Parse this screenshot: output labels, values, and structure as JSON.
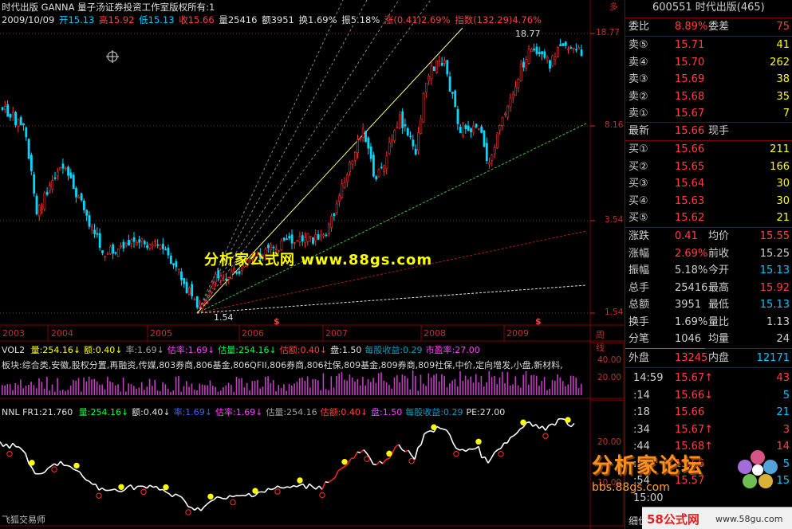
{
  "header": {
    "line1": "时代出版 GANNA 量子汤证券投资工作室版权所有:1",
    "line2": {
      "date": "2009/10/09",
      "open": "开15.13",
      "high": "高15.92",
      "low": "低15.13",
      "close": "收15.66",
      "vol": "量25416",
      "amount": "额3951",
      "turnover": "换1.69%",
      "amplitude": "振5.18%",
      "change": "涨(0.41)2.69%",
      "index": "指数(132.29)4.76%"
    },
    "sym_label": "多"
  },
  "price_axis": [
    "18.77",
    "8.16",
    "3.54",
    "1.54"
  ],
  "annotations": {
    "high_marker": "18.77",
    "low_marker": "1.54",
    "s_marker": "$"
  },
  "years": [
    "2003",
    "2004",
    "2005",
    "2006",
    "2007",
    "2008",
    "2009",
    "周线"
  ],
  "watermark_center": "分析家公式网  www.88gs.com",
  "vol_panel": {
    "label": "VOL2",
    "items": [
      {
        "t": "量:254.16↓",
        "c": "#ffff00"
      },
      {
        "t": "额:0.40↓",
        "c": "#ffff00"
      },
      {
        "t": "率:1.69↓",
        "c": "#a0a0a0"
      },
      {
        "t": "估率:1.69↓",
        "c": "#ff40ff"
      },
      {
        "t": "估量:254.16↓",
        "c": "#00ff40"
      },
      {
        "t": "估额:0.40↓",
        "c": "#ff4040"
      },
      {
        "t": "盘:1.50",
        "c": "#e0e0e0"
      },
      {
        "t": "每股收益:0.29",
        "c": "#00a0c0"
      },
      {
        "t": "市盈率:27.00",
        "c": "#ff40ff"
      }
    ],
    "sector": "板块:综合类,安徽,股权分置,再融资,传媒,803券商,806基金,806QFII,806券商,806社保,809基金,809券商,809社保,中价,定向增发,小盘,新材料,",
    "axis": [
      "40.00",
      "20.00"
    ]
  },
  "nnl_panel": {
    "label": "NNL FR1:21.760",
    "items": [
      {
        "t": "量:254.16↓",
        "c": "#00ff40"
      },
      {
        "t": "额:0.40↓",
        "c": "#e0e0e0"
      },
      {
        "t": "率:1.69↓",
        "c": "#4060ff"
      },
      {
        "t": "估率:1.69↓",
        "c": "#ff40ff"
      },
      {
        "t": "估量:254.16",
        "c": "#a0a0a0"
      },
      {
        "t": "估额:0.40↓",
        "c": "#ff4040"
      },
      {
        "t": "盘:1.50",
        "c": "#ff40ff"
      },
      {
        "t": "每股收益:0.29",
        "c": "#00a0c0"
      },
      {
        "t": "PE:27.00",
        "c": "#e0e0e0"
      }
    ],
    "axis": [
      "20.00",
      "10.00"
    ],
    "footer": "飞狐交易师"
  },
  "quote": {
    "title": "600551 时代出版(465)",
    "weibi_label": "委比",
    "weibi": "8.89%",
    "weicha_label": "委差",
    "weicha": "75",
    "sell": [
      {
        "label": "卖⑤",
        "price": "15.71",
        "vol": "41"
      },
      {
        "label": "卖④",
        "price": "15.70",
        "vol": "262"
      },
      {
        "label": "卖③",
        "price": "15.69",
        "vol": "38"
      },
      {
        "label": "卖②",
        "price": "15.68",
        "vol": "35"
      },
      {
        "label": "卖①",
        "price": "15.67",
        "vol": "7"
      }
    ],
    "latest_label": "最新",
    "latest": "15.66",
    "xianshou_label": "现手",
    "buy": [
      {
        "label": "买①",
        "price": "15.66",
        "vol": "211"
      },
      {
        "label": "买②",
        "price": "15.65",
        "vol": "166"
      },
      {
        "label": "买③",
        "price": "15.64",
        "vol": "30"
      },
      {
        "label": "买④",
        "price": "15.63",
        "vol": "30"
      },
      {
        "label": "买⑤",
        "price": "15.62",
        "vol": "21"
      }
    ],
    "stats": [
      {
        "l1": "涨跌",
        "v1": "0.41",
        "l2": "均价",
        "v2": "15.55",
        "c1": "#ff4040",
        "c2": "#ff4040"
      },
      {
        "l1": "涨幅",
        "v1": "2.69%",
        "l2": "前收",
        "v2": "15.25",
        "c1": "#ff4040",
        "c2": "#d0d0d0"
      },
      {
        "l1": "振幅",
        "v1": "5.18%",
        "l2": "今开",
        "v2": "15.13",
        "c1": "#d0d0d0",
        "c2": "#00c8ff"
      },
      {
        "l1": "总手",
        "v1": "25416",
        "l2": "最高",
        "v2": "15.92",
        "c1": "#d0d0d0",
        "c2": "#ff4040"
      },
      {
        "l1": "总额",
        "v1": "3951",
        "l2": "最低",
        "v2": "15.13",
        "c1": "#d0d0d0",
        "c2": "#00c8ff"
      },
      {
        "l1": "换手",
        "v1": "1.69%",
        "l2": "量比",
        "v2": "1.13",
        "c1": "#d0d0d0",
        "c2": "#d0d0d0"
      },
      {
        "l1": "分笔",
        "v1": "1046",
        "l2": "均量",
        "v2": "24",
        "c1": "#d0d0d0",
        "c2": "#d0d0d0"
      }
    ],
    "waipan_label": "外盘",
    "waipan": "13245",
    "neipan_label": "内盘",
    "neipan": "12171",
    "ticks": [
      {
        "time": "14:59",
        "price": "15.67↑",
        "vol": "43",
        "pc": "#ff4040",
        "vc": "#ff4040"
      },
      {
        "time": ":14",
        "price": "15.66↓",
        "vol": "5",
        "pc": "#ff4040",
        "vc": "#00c8ff"
      },
      {
        "time": ":18",
        "price": "15.66",
        "vol": "21",
        "pc": "#ff4040",
        "vc": "#00c8ff"
      },
      {
        "time": ":34",
        "price": "15.67↑",
        "vol": "3",
        "pc": "#ff4040",
        "vc": "#ff4040"
      },
      {
        "time": ":44",
        "price": "15.68↑",
        "vol": "14",
        "pc": "#ff4040",
        "vc": "#ff4040"
      },
      {
        "time": ":53",
        "price": "15.66",
        "vol": "5",
        "pc": "#ff4040",
        "vc": "#00c8ff"
      },
      {
        "time": ":54",
        "price": "15.57",
        "vol": "15",
        "pc": "#ff4040",
        "vc": "#00c8ff"
      },
      {
        "time": "15:00",
        "price": "",
        "vol": "",
        "pc": "#ff4040",
        "vc": "#00c8ff"
      }
    ],
    "footer_label": "细价"
  },
  "overlays": {
    "forum_cn": "分析家论坛",
    "forum_url": "bbs.88gs.com",
    "site_58": "58公式网",
    "site_url": "www.58gu.com"
  }
}
